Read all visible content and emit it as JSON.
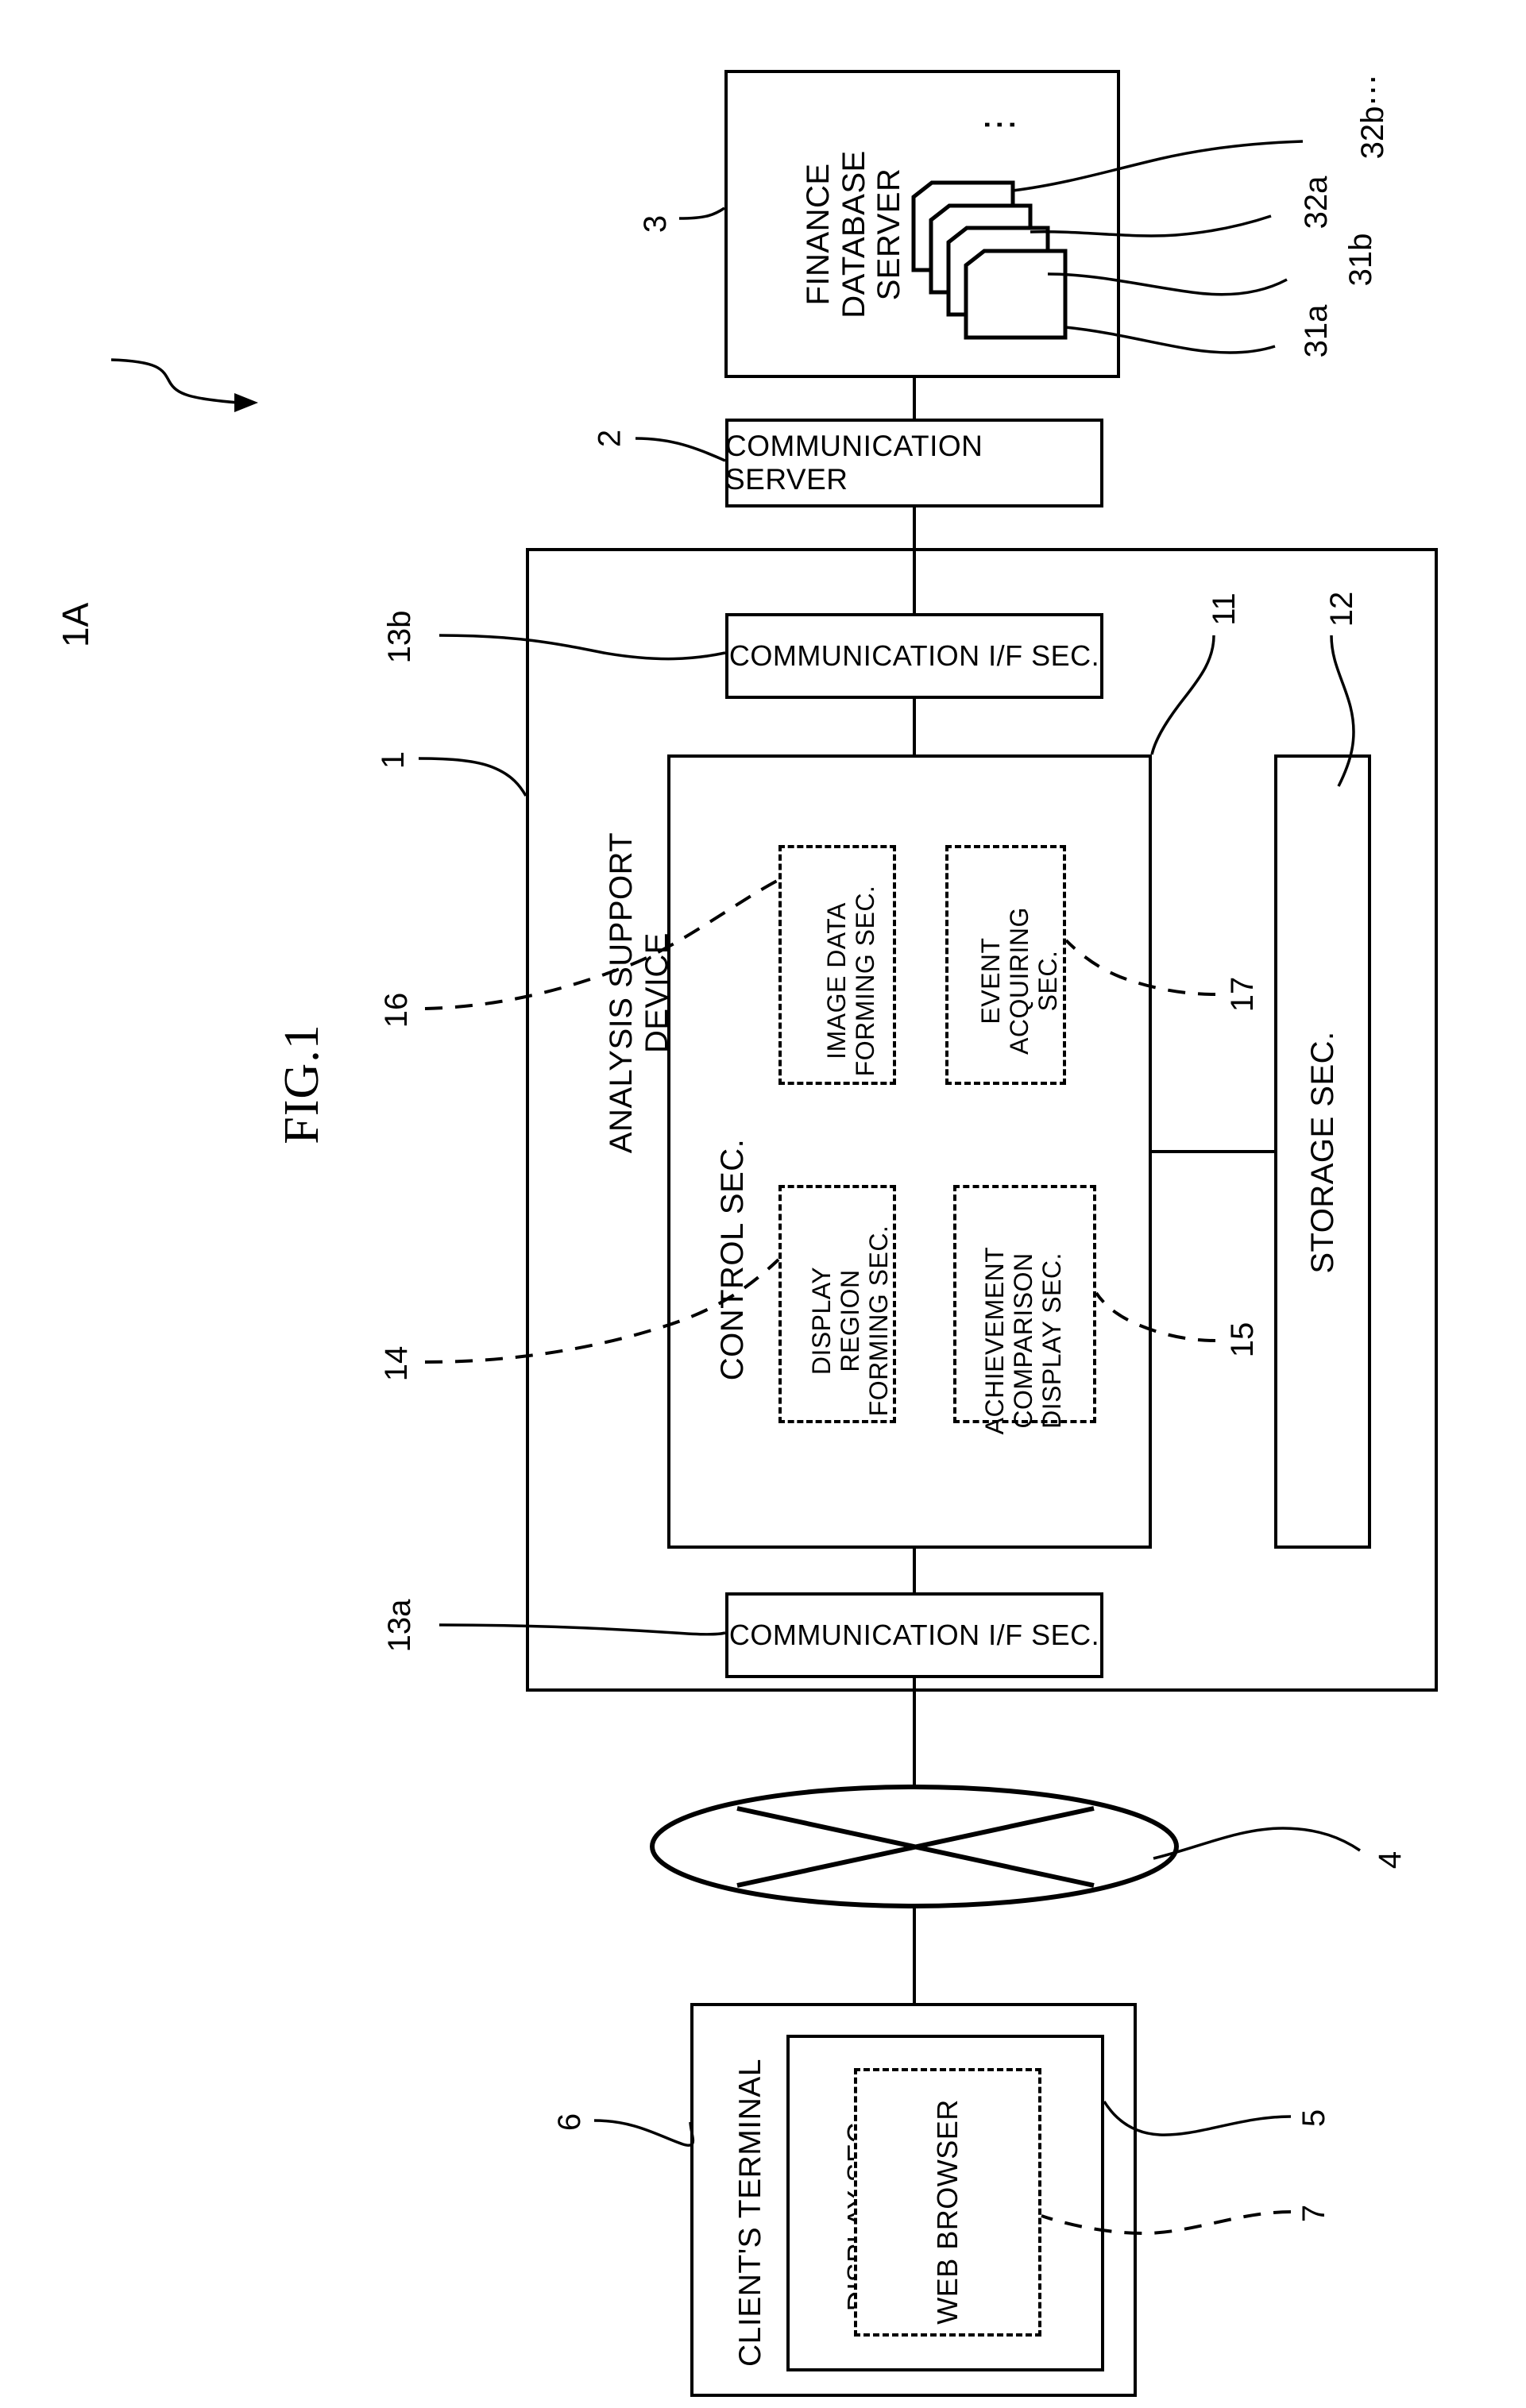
{
  "figure": {
    "title": "FIG.1",
    "system_label": "1A"
  },
  "nodes": {
    "finance_db_server": {
      "label": "FINANCE DATABASE SERVER",
      "ref": "3"
    },
    "communication_server": {
      "label": "COMMUNICATION SERVER",
      "ref": "2"
    },
    "analysis_support_device": {
      "label": "ANALYSIS SUPPORT DEVICE",
      "ref": "1"
    },
    "comm_if_upper": {
      "label": "COMMUNICATION I/F SEC.",
      "ref": "13b"
    },
    "comm_if_lower": {
      "label": "COMMUNICATION I/F SEC.",
      "ref": "13a"
    },
    "control_sec": {
      "label": "CONTROL SEC.",
      "ref": "11"
    },
    "storage_sec": {
      "label": "STORAGE SEC.",
      "ref": "12"
    },
    "image_data_forming_sec": {
      "label": "IMAGE DATA FORMING SEC.",
      "ref": "16"
    },
    "event_acquiring_sec": {
      "label": "EVENT ACQUIRING SEC.",
      "ref": "17"
    },
    "display_region_forming_sec": {
      "label": "DISPLAY REGION FORMING SEC.",
      "ref": "14"
    },
    "achievement_comparison_display_sec": {
      "label": "ACHIEVEMENT COMPARISON DISPLAY SEC.",
      "ref": "15"
    },
    "network": {
      "label": "",
      "ref": "4"
    },
    "clients_terminal": {
      "label": "CLIENT'S TERMINAL",
      "ref": "6"
    },
    "display_sec": {
      "label": "DISPLAY SEC.",
      "ref": "5"
    },
    "web_browser": {
      "label": "WEB BROWSER",
      "ref": "7"
    }
  },
  "database_stack": {
    "refs": [
      "31a",
      "31b",
      "32a",
      "32b⋯"
    ],
    "ellipsis": "⋮"
  },
  "colors": {
    "ink": "#000000",
    "paper": "#ffffff"
  }
}
